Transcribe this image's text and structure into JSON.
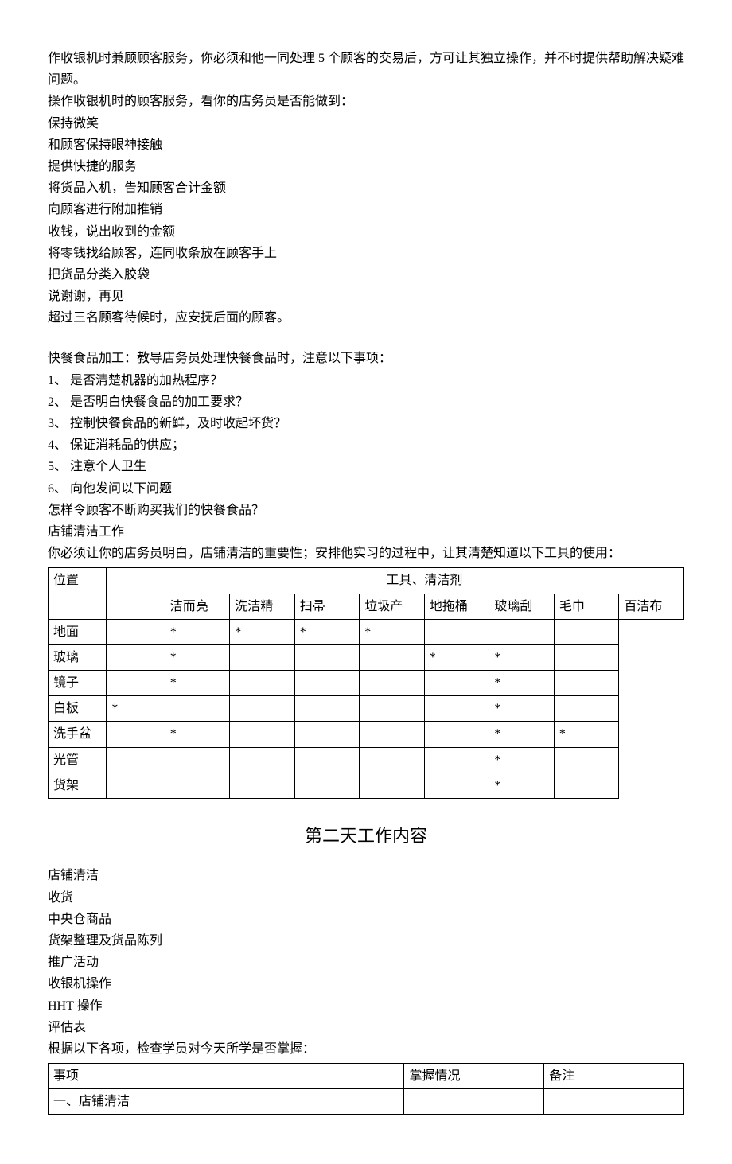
{
  "lines": {
    "l1": "作收银机时兼顾顾客服务，你必须和他一同处理 5 个顾客的交易后，方可让其独立操作，并不时提供帮助解决疑难问题。",
    "l2": "操作收银机时的顾客服务，看你的店务员是否能做到：",
    "l3": "保持微笑",
    "l4": "和顾客保持眼神接触",
    "l5": "提供快捷的服务",
    "l6": "将货品入机，告知顾客合计金额",
    "l7": "向顾客进行附加推销",
    "l8": "收钱，说出收到的金额",
    "l9": "将零钱找给顾客，连同收条放在顾客手上",
    "l10": "把货品分类入胶袋",
    "l11": "说谢谢，再见",
    "l12": "超过三名顾客待候时，应安抚后面的顾客。",
    "l13": "快餐食品加工：教导店务员处理快餐食品时，注意以下事项：",
    "l14": "1、 是否清楚机器的加热程序？",
    "l15": "2、 是否明白快餐食品的加工要求？",
    "l16": "3、 控制快餐食品的新鲜，及时收起坏货？",
    "l17": "4、 保证消耗品的供应；",
    "l18": "5、 注意个人卫生",
    "l19": "6、 向他发问以下问题",
    "l20": "怎样令顾客不断购买我们的快餐食品？",
    "l21": "店铺清洁工作",
    "l22": "你必须让你的店务员明白，店铺清洁的重要性；安排他实习的过程中，让其清楚知道以下工具的使用：",
    "l23": "店铺清洁",
    "l24": "收货",
    "l25": "中央仓商品",
    "l26": "货架整理及货品陈列",
    "l27": "推广活动",
    "l28": "收银机操作",
    "l29": "HHT 操作",
    "l30": "评估表",
    "l31": "根据以下各项，检查学员对今天所学是否掌握："
  },
  "heading": "第二天工作内容",
  "table1": {
    "h_pos": "位置",
    "h_tools": "工具、清洁剂",
    "cols": [
      "洁而亮",
      "洗洁精",
      "扫帚",
      "垃圾产",
      "地拖桶",
      "玻璃刮",
      "毛巾",
      "百洁布"
    ],
    "rows": [
      {
        "label": "地面",
        "cells": [
          "",
          "*",
          "*",
          "*",
          "*",
          "",
          "",
          ""
        ]
      },
      {
        "label": "玻璃",
        "cells": [
          "",
          "*",
          "",
          "",
          "",
          "*",
          "*",
          ""
        ]
      },
      {
        "label": "镜子",
        "cells": [
          "",
          "*",
          "",
          "",
          "",
          "",
          "*",
          ""
        ]
      },
      {
        "label": "白板",
        "cells": [
          "*",
          "",
          "",
          "",
          "",
          "",
          "*",
          ""
        ]
      },
      {
        "label": "洗手盆",
        "cells": [
          "",
          "*",
          "",
          "",
          "",
          "",
          "*",
          "*"
        ]
      },
      {
        "label": "光管",
        "cells": [
          "",
          "",
          "",
          "",
          "",
          "",
          "*",
          ""
        ]
      },
      {
        "label": "货架",
        "cells": [
          "",
          "",
          "",
          "",
          "",
          "",
          "*",
          ""
        ]
      }
    ]
  },
  "table2": {
    "h1": "事项",
    "h2": "掌握情况",
    "h3": "备注",
    "r1": "一、店铺清洁"
  }
}
